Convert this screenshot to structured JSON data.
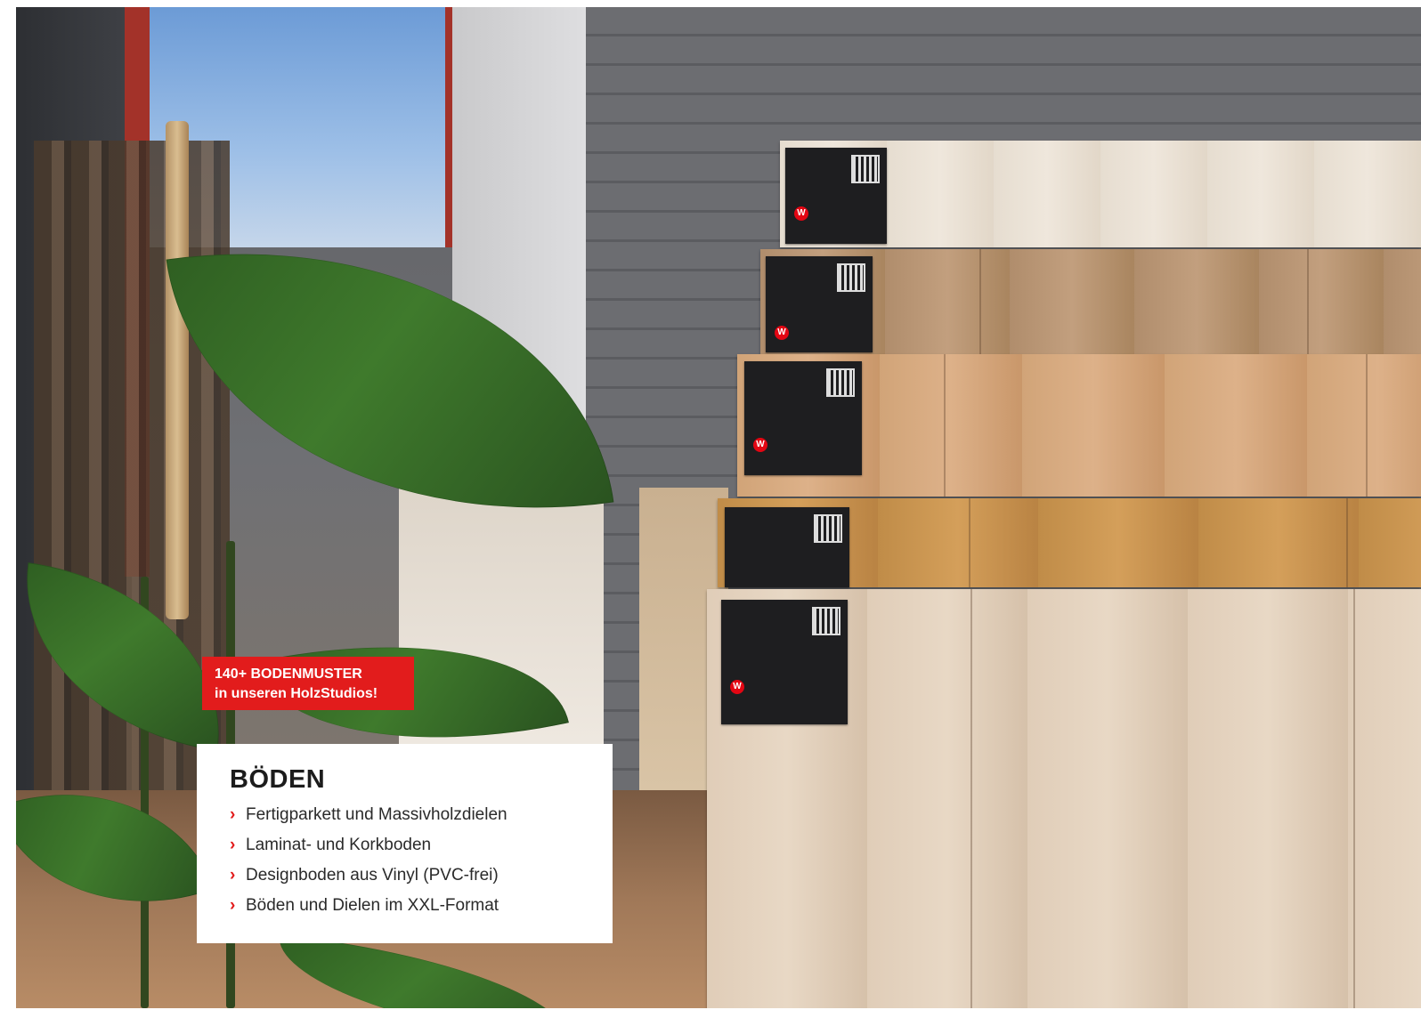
{
  "badge": {
    "line1": "140+ BODENMUSTER",
    "line2": "in unseren HolzStudios!",
    "color": "#e21c1c"
  },
  "card": {
    "title": "BÖDEN",
    "bullet_icon": "chevron-right-icon",
    "items": [
      "Fertigparkett und Massivholzdielen",
      "Laminat- und Korkboden",
      "Designboden aus Vinyl (PVC-frei)",
      "Böden und Dielen im XXL-Format"
    ]
  },
  "brand": {
    "logo_letter": "W",
    "accent": "#e30613"
  }
}
